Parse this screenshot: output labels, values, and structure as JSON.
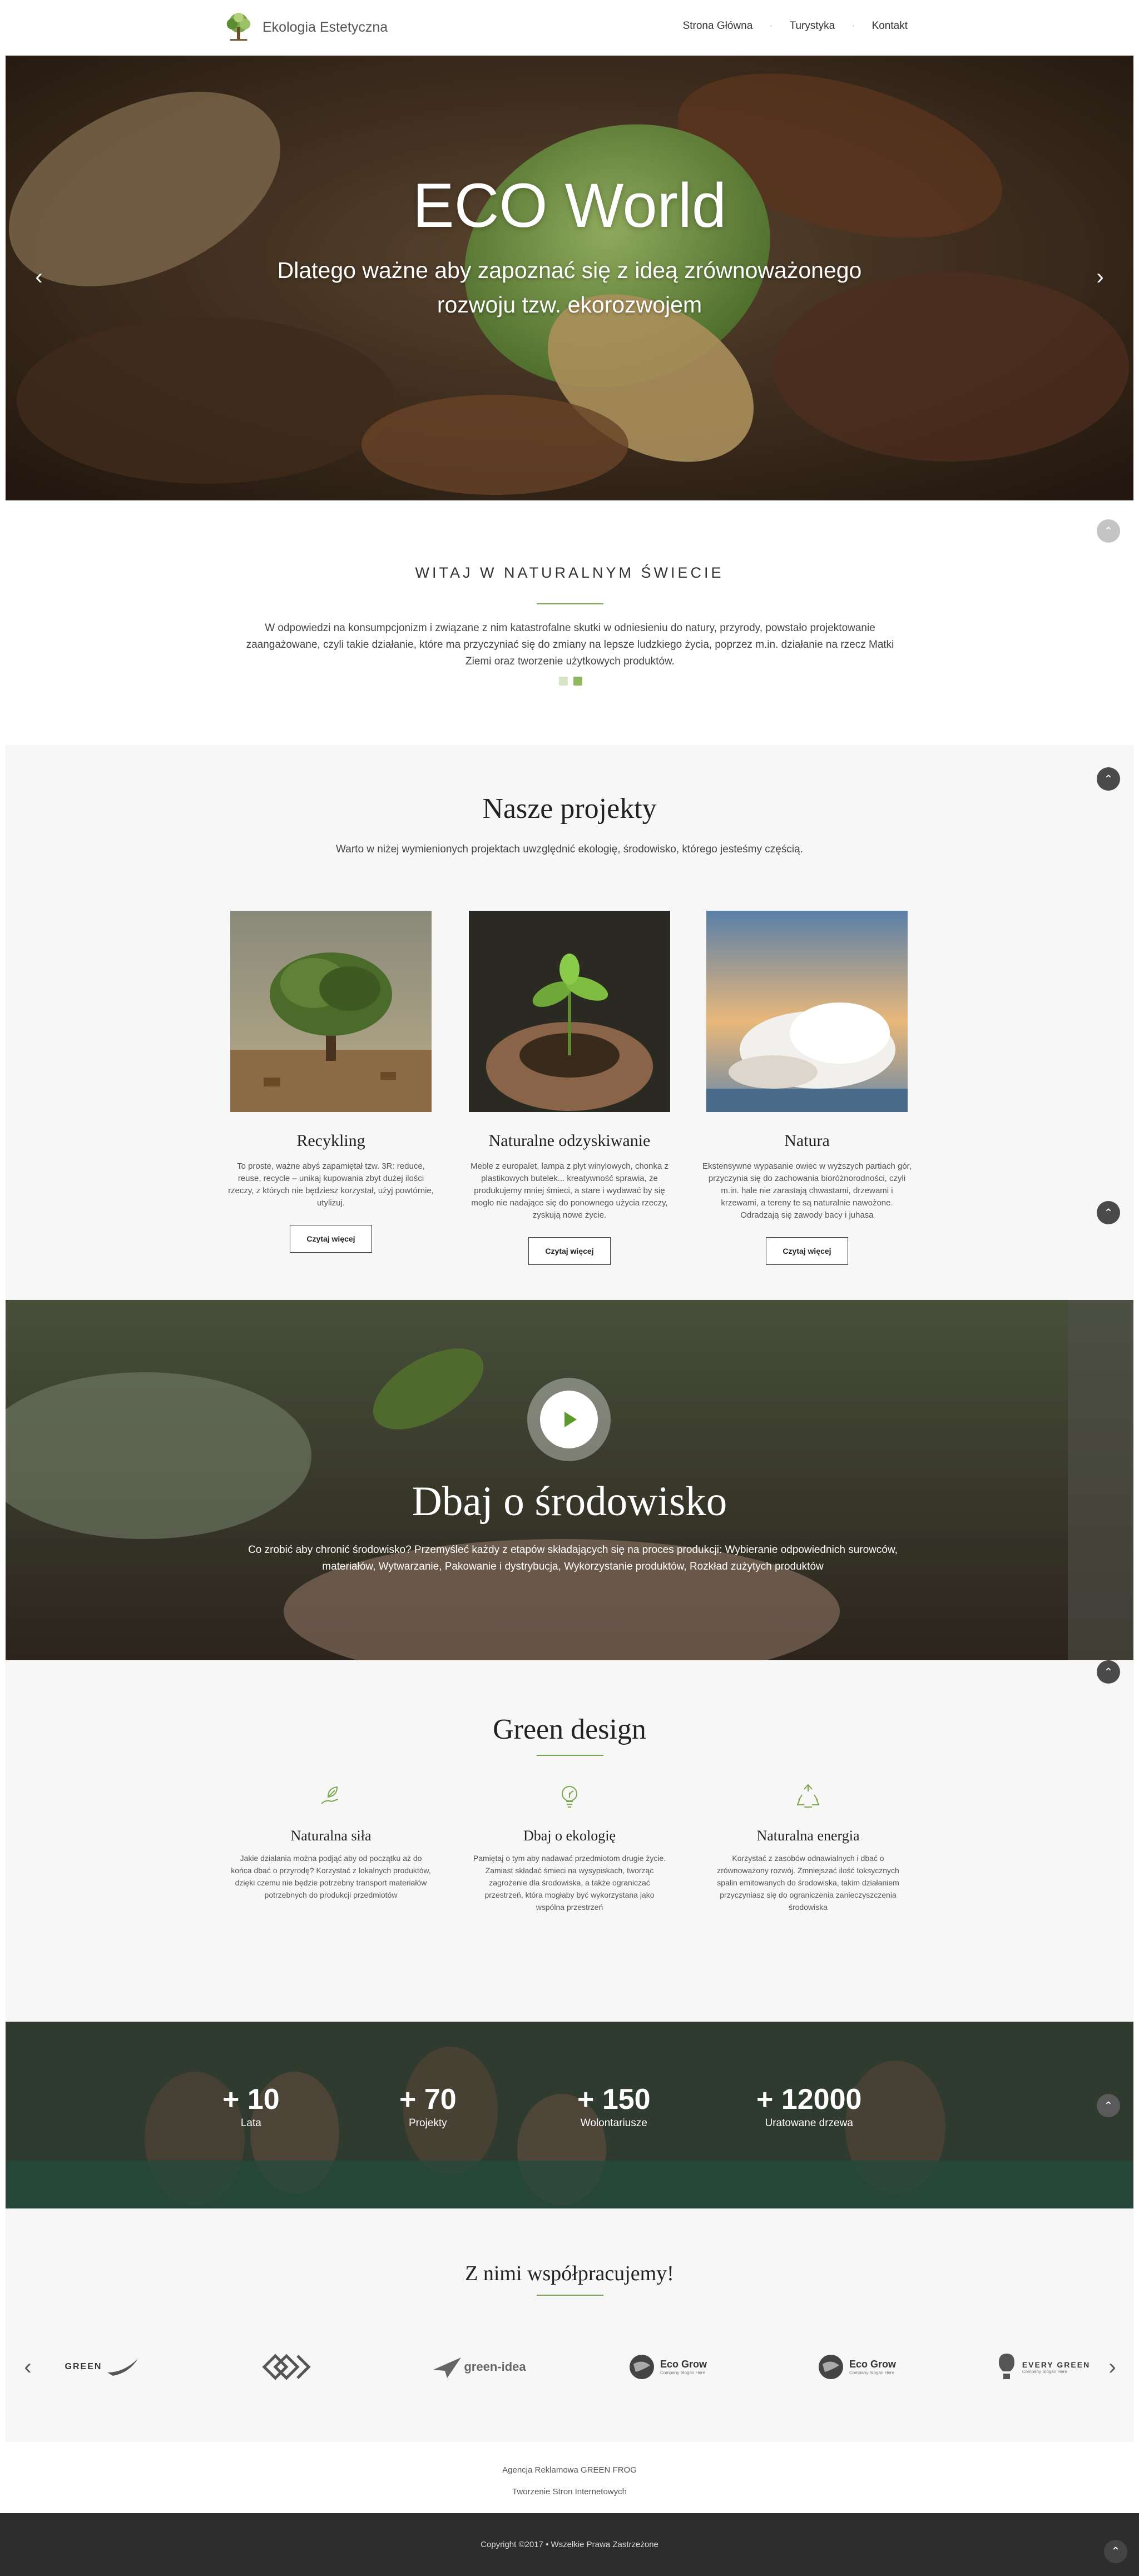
{
  "header": {
    "logo_text": "Ekologia Estetyczna",
    "nav": [
      "Strona Główna",
      "Turystyka",
      "Kontakt"
    ]
  },
  "hero": {
    "title": "ECO World",
    "subtitle": "Dlatego ważne aby zapoznać się z ideą zrównoważonego rozwoju tzw. ekorozwojem"
  },
  "welcome": {
    "heading": "WITAJ W NATURALNYM ŚWIECIE",
    "text": "W odpowiedzi na konsumpcjonizm i związane z nim katastrofalne skutki w odniesieniu do natury, przyrody, powstało projektowanie zaangażowane, czyli takie działanie, które ma przyczyniać się do zmiany na lepsze ludzkiego życia, poprzez m.in. działanie na rzecz Matki Ziemi oraz tworzenie użytkowych produktów."
  },
  "projects": {
    "heading": "Nasze projekty",
    "lead": "Warto w niżej wymienionych projektach uwzględnić ekologię, środowisko, którego jesteśmy częścią.",
    "items": [
      {
        "title": "Recykling",
        "text": "To proste, ważne abyś zapamiętał tzw. 3R: reduce, reuse, recycle – unikaj kupowania zbyt dużej ilości rzeczy, z których nie będziesz korzystał, użyj powtórnie, utylizuj.",
        "button": "Czytaj więcej"
      },
      {
        "title": "Naturalne odzyskiwanie",
        "text": "Meble z europalet, lampa z płyt winylowych, chonka z plastikowych butelek... kreatywność sprawia, że produkujemy mniej śmieci, a stare i wydawać by się mogło nie nadające się do ponownego użycia rzeczy, zyskują nowe życie.",
        "button": "Czytaj więcej"
      },
      {
        "title": "Natura",
        "text": "Ekstensywne wypasanie owiec w wyższych partiach gór, przyczynia się do zachowania bioróżnorodności, czyli m.in. hale nie zarastają chwastami, drzewami i krzewami, a tereny te są naturalnie nawożone. Odradzają się zawody bacy i juhasa",
        "button": "Czytaj więcej"
      }
    ]
  },
  "video": {
    "heading": "Dbaj o środowisko",
    "text": "Co zrobić aby chronić środowisko? Przemyśleć każdy z etapów składających się na proces produkcji: Wybieranie odpowiednich surowców, materiałów, Wytwarzanie, Pakowanie i dystrybucja, Wykorzystanie produktów, Rozkład zużytych produktów"
  },
  "green": {
    "heading": "Green design",
    "features": [
      {
        "icon": "leaf-hand-icon",
        "title": "Naturalna siła",
        "text": "Jakie działania można podjąć aby od początku aż do końca dbać o przyrodę? Korzystać z lokalnych produktów, dzięki czemu nie będzie potrzebny transport materiałów potrzebnych do produkcji przedmiotów"
      },
      {
        "icon": "eco-bulb-icon",
        "title": "Dbaj o ekologię",
        "text": "Pamiętaj o tym aby nadawać przedmiotom drugie życie. Zamiast składać śmieci na wysypiskach, tworząc zagrożenie dla środowiska, a także ograniczać przestrzeń, która mogłaby być wykorzystana jako wspólna przestrzeń"
      },
      {
        "icon": "recycle-icon",
        "title": "Naturalna energia",
        "text": "Korzystać z zasobów odnawialnych i dbać o zrównoważony rozwój. Zmniejszać ilość toksycznych spalin emitowanych do środowiska, takim działaniem przyczyniasz się do ograniczenia zanieczyszczenia środowiska"
      }
    ]
  },
  "stats": [
    {
      "value": "+ 10",
      "label": "Lata"
    },
    {
      "value": "+ 70",
      "label": "Projekty"
    },
    {
      "value": "+ 150",
      "label": "Wolontariusze"
    },
    {
      "value": "+ 12000",
      "label": "Uratowane drzewa"
    }
  ],
  "partners": {
    "heading": "Z nimi współpracujemy!",
    "logos": [
      "GREEN",
      "",
      "green-idea",
      "Eco Grow",
      "Eco Grow",
      "EVERY GREEN"
    ],
    "logo_subs": [
      "",
      "",
      "",
      "Company Slogan Here",
      "Company Slogan Here",
      "Company Slogan Here"
    ]
  },
  "footer": {
    "links": [
      "Agencja Reklamowa GREEN FROG",
      "Tworzenie Stron Internetowych"
    ],
    "copyright": "Copyright ©2017 • Wszelkie Prawa Zastrzeżone"
  },
  "colors": {
    "accent": "#7aa84a",
    "dark": "#2d2d2d",
    "scroll_button": "#4a4a4a"
  }
}
